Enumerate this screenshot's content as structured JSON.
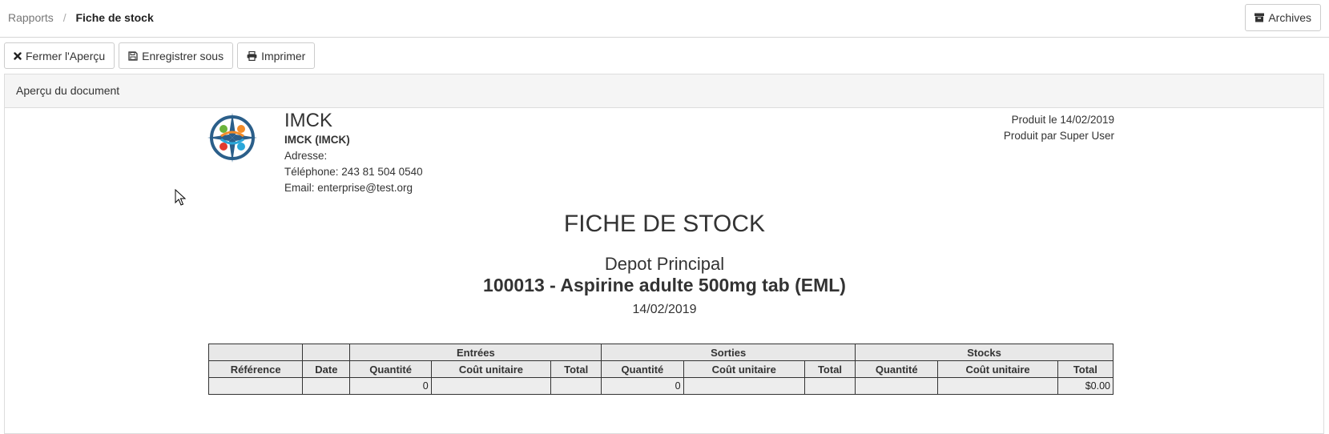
{
  "breadcrumb": {
    "parent": "Rapports",
    "separator": "/",
    "current": "Fiche de stock"
  },
  "header": {
    "archives_label": "Archives",
    "archives_icon": "archive-icon"
  },
  "toolbar": {
    "close_label": "Fermer l'Aperçu",
    "close_icon": "times-icon",
    "save_label": "Enregistrer sous",
    "save_icon": "floppy-disk-icon",
    "print_label": "Imprimer",
    "print_icon": "printer-icon"
  },
  "panel": {
    "heading": "Aperçu du document"
  },
  "company": {
    "name": "IMCK",
    "full_name": "IMCK (IMCK)",
    "address": "Adresse:",
    "phone": "Téléphone: 243 81 504 0540",
    "email": "Email: enterprise@test.org"
  },
  "meta": {
    "produced_on": "Produit le 14/02/2019",
    "produced_by": "Produit par Super User"
  },
  "report": {
    "title": "FICHE DE STOCK",
    "depot": "Depot Principal",
    "product": "100013 - Aspirine adulte 500mg tab (EML)",
    "date": "14/02/2019"
  },
  "table": {
    "groups": [
      "Entrées",
      "Sorties",
      "Stocks"
    ],
    "columns": [
      "Référence",
      "Date",
      "Quantité",
      "Coût unitaire",
      "Total",
      "Quantité",
      "Coût unitaire",
      "Total",
      "Quantité",
      "Coût unitaire",
      "Total"
    ],
    "row": [
      "",
      "",
      "0",
      "",
      "",
      "0",
      "",
      "",
      "",
      "",
      "$0.00"
    ]
  },
  "colors": {
    "border": "#333333",
    "header_bg": "#e8e8e8",
    "panel_heading_bg": "#f5f5f5"
  }
}
